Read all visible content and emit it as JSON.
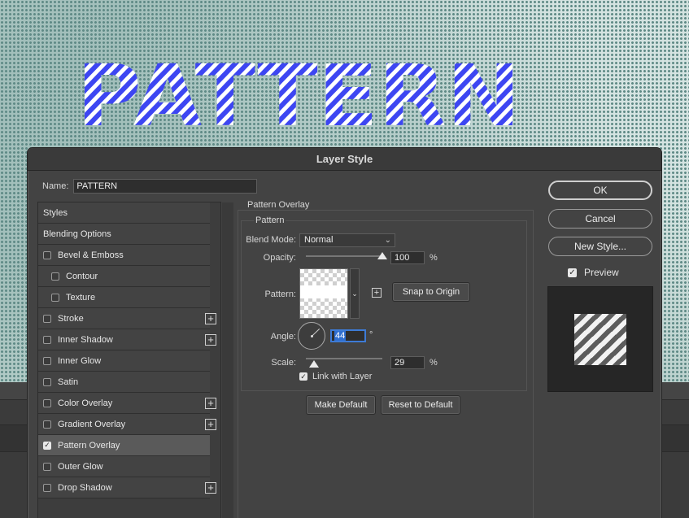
{
  "canvas": {
    "text": "PATTERN",
    "text_color": "#3d46f2"
  },
  "dialog": {
    "title": "Layer Style",
    "name_label": "Name:",
    "name_value": "PATTERN"
  },
  "styles_list": {
    "items": [
      {
        "label": "Styles",
        "type": "header"
      },
      {
        "label": "Blending Options",
        "type": "header"
      },
      {
        "label": "Bevel & Emboss",
        "checked": false,
        "add": false
      },
      {
        "label": "Contour",
        "checked": false,
        "sub": true,
        "add": false
      },
      {
        "label": "Texture",
        "checked": false,
        "sub": true,
        "add": false
      },
      {
        "label": "Stroke",
        "checked": false,
        "add": true
      },
      {
        "label": "Inner Shadow",
        "checked": false,
        "add": true
      },
      {
        "label": "Inner Glow",
        "checked": false,
        "add": false
      },
      {
        "label": "Satin",
        "checked": false,
        "add": false
      },
      {
        "label": "Color Overlay",
        "checked": false,
        "add": true
      },
      {
        "label": "Gradient Overlay",
        "checked": false,
        "add": true
      },
      {
        "label": "Pattern Overlay",
        "checked": true,
        "add": false,
        "selected": true
      },
      {
        "label": "Outer Glow",
        "checked": false,
        "add": false
      },
      {
        "label": "Drop Shadow",
        "checked": false,
        "add": true
      }
    ]
  },
  "pattern_overlay": {
    "section_title": "Pattern Overlay",
    "group_title": "Pattern",
    "blend_mode_label": "Blend Mode:",
    "blend_mode_value": "Normal",
    "opacity_label": "Opacity:",
    "opacity_value": "100",
    "opacity_unit": "%",
    "opacity_level": 1.0,
    "pattern_label": "Pattern:",
    "snap_button": "Snap to Origin",
    "angle_label": "Angle:",
    "angle_value": "44",
    "angle_unit": "°",
    "scale_label": "Scale:",
    "scale_value": "29",
    "scale_unit": "%",
    "link_label": "Link with Layer",
    "link_checked": true,
    "make_default": "Make Default",
    "reset_default": "Reset to Default"
  },
  "actions": {
    "ok": "OK",
    "cancel": "Cancel",
    "new_style": "New Style...",
    "preview_label": "Preview",
    "preview_checked": true
  },
  "icons": {
    "add": "plus-square-icon",
    "check": "checkmark-icon",
    "dropdown": "chevron-down-icon"
  }
}
